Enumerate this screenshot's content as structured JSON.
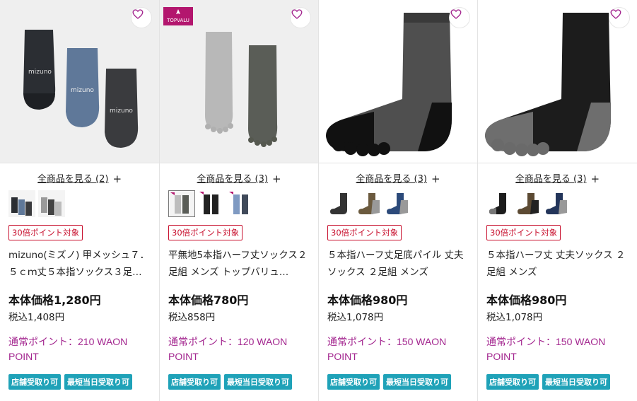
{
  "colors": {
    "point_badge": "#c8102e",
    "points_text": "#a3268f",
    "service_badge": "#1fa2b8"
  },
  "products": [
    {
      "see_all": "全商品を見る (2)",
      "point_badge": "30倍ポイント対象",
      "title": "mizuno(ミズノ) 甲メッシュ７．５ｃｍ丈５本指ソックス３足…",
      "price": "本体価格1,280円",
      "tax": "税込1,408円",
      "points": "通常ポイント：210 WAON POINT",
      "services": [
        "店舗受取り可",
        "最短当日受取り可"
      ],
      "icon": "heart-icon"
    },
    {
      "brand_logo": "TOPVALU",
      "see_all": "全商品を見る (3)",
      "point_badge": "30倍ポイント対象",
      "title": "平無地5本指ハーフ丈ソックス２足組 メンズ トップバリュ…",
      "price": "本体価格780円",
      "tax": "税込858円",
      "points": "通常ポイント：120 WAON POINT",
      "services": [
        "店舗受取り可",
        "最短当日受取り可"
      ],
      "icon": "heart-icon"
    },
    {
      "see_all": "全商品を見る (3)",
      "point_badge": "30倍ポイント対象",
      "title": "５本指ハーフ丈足底パイル 丈夫ソックス ２足組 メンズ",
      "price": "本体価格980円",
      "tax": "税込1,078円",
      "points": "通常ポイント：150 WAON POINT",
      "services": [
        "店舗受取り可",
        "最短当日受取り可"
      ],
      "icon": "heart-icon"
    },
    {
      "see_all": "全商品を見る (3)",
      "point_badge": "30倍ポイント対象",
      "title": "５本指ハーフ丈 丈夫ソックス ２足組 メンズ",
      "price": "本体価格980円",
      "tax": "税込1,078円",
      "points": "通常ポイント：150 WAON POINT",
      "services": [
        "店舗受取り可",
        "最短当日受取り可"
      ],
      "icon": "heart-icon"
    }
  ]
}
